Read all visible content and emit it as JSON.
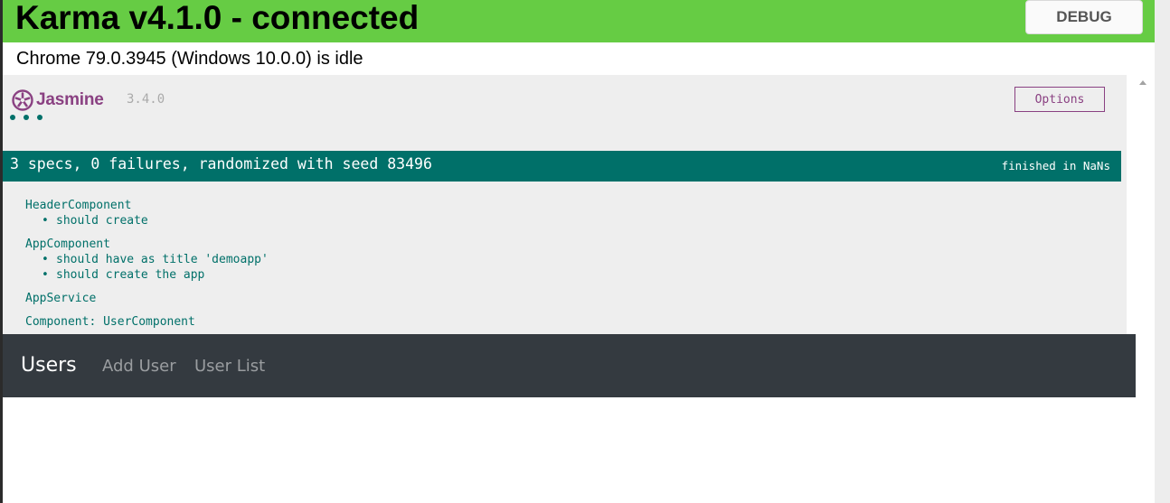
{
  "karma": {
    "title": "Karma v4.1.0 - connected",
    "debug_label": "DEBUG",
    "browser_status": "Chrome 79.0.3945 (Windows 10.0.0) is idle"
  },
  "jasmine": {
    "logo_text": "Jasmine",
    "version": "3.4.0",
    "options_label": "Options",
    "summary": "3 specs, 0 failures, randomized with seed 83496",
    "duration": "finished in NaNs",
    "suites": [
      {
        "name": "HeaderComponent",
        "specs": [
          "should create"
        ]
      },
      {
        "name": "AppComponent",
        "specs": [
          "should have as title 'demoapp'",
          "should create the app"
        ]
      },
      {
        "name": "AppService",
        "specs": []
      },
      {
        "name": "Component: UserComponent",
        "specs": []
      }
    ]
  },
  "navbar": {
    "brand": "Users",
    "links": [
      "Add User",
      "User List"
    ]
  },
  "colors": {
    "karma_green": "#66cc44",
    "jasmine_teal": "#007069",
    "jasmine_purple": "#8a4182",
    "navbar_dark": "#343a40"
  },
  "icons": {
    "jasmine_logo": "jasmine-flower-icon",
    "scroll_up": "scroll-up-arrow-icon"
  }
}
